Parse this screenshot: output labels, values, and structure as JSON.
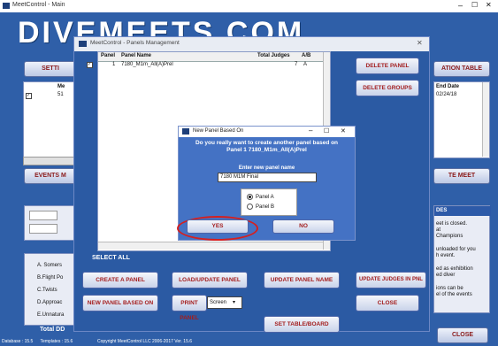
{
  "main": {
    "title": "MeetControl - Main",
    "brand": "DIVEMEETS.COM",
    "settings_btn": "SETTI",
    "table_btn": "ATION TABLE",
    "left_col_head": "Me",
    "left_row_num": "51",
    "right_col_head": "End Date",
    "right_row_val": "02/24/18",
    "events_btn": "EVENTS M",
    "meet_btn": "TE MEET",
    "des_head": "DES",
    "notes": [
      "eet is closed.",
      "at",
      "Champions",
      "",
      "unloaded for you",
      "h event.",
      "",
      "ed as exhibition",
      "ed diver",
      "",
      "ions can be",
      "el of the events"
    ],
    "left_list": [
      "A. Somers",
      "B.Flight Po",
      "C.Twists",
      "D.Approac",
      "E.Unnatura"
    ],
    "total_dd": "Total DD",
    "close_btn": "CLOSE",
    "footer": "Database : 15.5      Templates : 15.6                    Copyright MeetControl LLC 2006-2017 Ver. 15.6"
  },
  "panels": {
    "title": "MeetControl - Panels Management",
    "columns": [
      "Panel",
      "Panel Name",
      "Total Judges",
      "A/B"
    ],
    "rows": [
      {
        "panel": "1",
        "name": "7180_M1m_All(A)Prel",
        "judges": "7",
        "ab": "A"
      }
    ],
    "delete_panel": "DELETE PANEL",
    "delete_groups": "DELETE GROUPS",
    "select_all": "SELECT ALL",
    "create_panel": "CREATE A PANEL",
    "load_update": "LOAD/UPDATE PANEL",
    "update_name": "UPDATE PANEL NAME",
    "update_judges": "UPDATE JUDGES IN PNL",
    "new_based": "NEW PANEL BASED ON",
    "print_panel": "PRINT PANEL",
    "print_target": "Screen",
    "close": "CLOSE",
    "set_table": "SET TABLE/BOARD"
  },
  "dialog": {
    "title": "New Panel Based On",
    "message_line1": "Do you really want to create another panel based on",
    "message_line2": "Panel 1 7180_M1m_All(A)Prel",
    "prompt": "Enter new panel name",
    "input_value": "7180 M1M Final",
    "radio_a": "Panel A",
    "radio_b": "Panel B",
    "yes": "YES",
    "no": "NO"
  },
  "colors": {
    "window_bg": "#2f5fa8",
    "dialog_bg": "#4472c4",
    "button_text": "#a31d1d",
    "highlight": "#d42020"
  }
}
